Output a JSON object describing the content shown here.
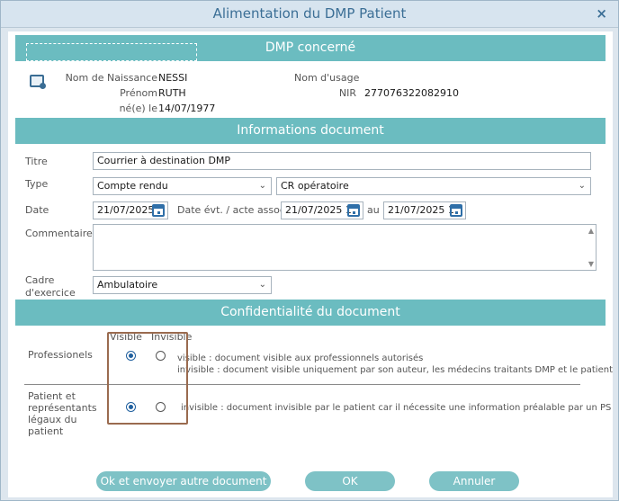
{
  "window": {
    "title": "Alimentation du DMP Patient",
    "close_glyph": "×"
  },
  "sections": {
    "dmp": "DMP concerné",
    "info": "Informations document",
    "conf": "Confidentialité du document"
  },
  "patient": {
    "nom_naissance_label": "Nom de Naissance",
    "nom_naissance": "NESSI",
    "prenom_label": "Prénom",
    "prenom": "RUTH",
    "ne_le_label": "né(e) le",
    "ne_le": "14/07/1977",
    "nom_usage_label": "Nom d'usage",
    "nom_usage": "",
    "nir_label": "NIR",
    "nir": "277076322082910"
  },
  "document": {
    "titre_label": "Titre",
    "titre": "Courrier à destination DMP",
    "type_label": "Type",
    "type_value": "Compte rendu",
    "subtype_value": "CR opératoire",
    "date_label": "Date",
    "date_value": "21/07/2025",
    "date_evt_label": "Date évt. / acte associé",
    "date_evt_from": "21/07/2025 1",
    "au_label": "au",
    "date_evt_to": "21/07/2025 1",
    "commentaires_label": "Commentaires",
    "commentaires": "",
    "cadre_label": "Cadre d'exercice",
    "cadre_value": "Ambulatoire"
  },
  "confidentialite": {
    "visible_header": "Visible",
    "invisible_header": "Invisible",
    "professionnels_label": "Professionels",
    "professionnels_visible_desc": "visible : document visible aux professionnels autorisés",
    "professionnels_invisible_desc": "invisible : document visible uniquement par son auteur, les médecins traitants DMP et le patient",
    "patient_label": "Patient et représentants légaux du patient",
    "patient_invisible_desc": "invisible : document invisible par le patient car il nécessite une information préalable par un PS",
    "professionnels_selected": "visible",
    "patient_selected": "visible"
  },
  "buttons": {
    "ok_send_other": "Ok et envoyer autre document",
    "ok": "OK",
    "cancel": "Annuler"
  },
  "icons": {
    "patient": "patient-card-icon",
    "calendar": "calendar-icon",
    "chevron": "chevron-down-icon"
  }
}
